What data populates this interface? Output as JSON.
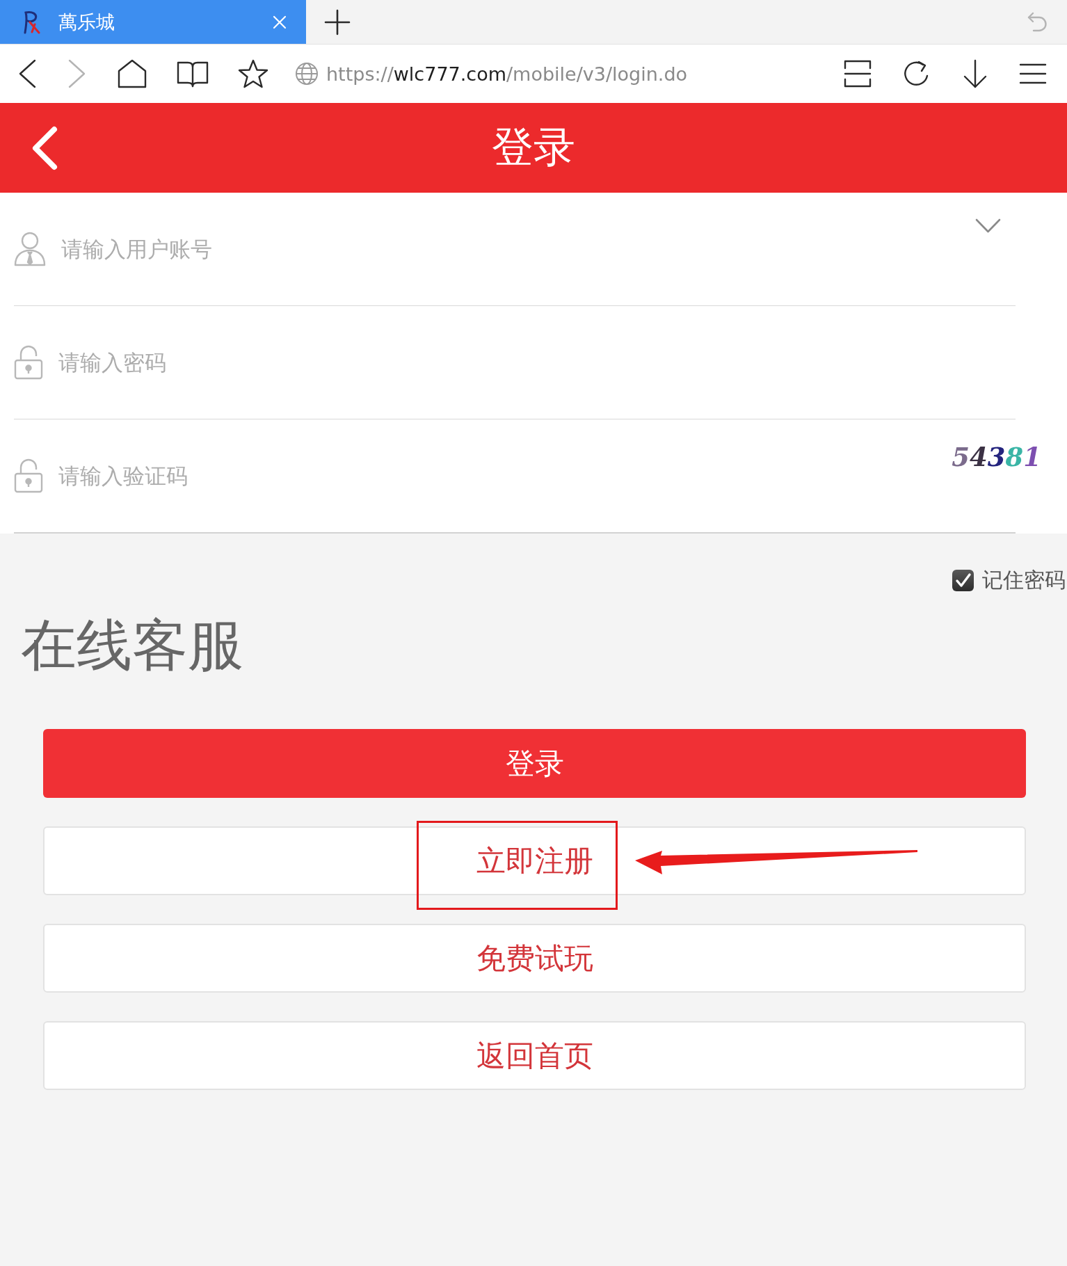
{
  "browser": {
    "tabs": [
      {
        "title": "萬乐城",
        "selected": true
      }
    ],
    "tab_actions": [
      {
        "kind": "undo",
        "disabled": true
      }
    ],
    "toolbar_left": [
      {
        "kind": "back",
        "disabled": false
      },
      {
        "kind": "forward",
        "disabled": true
      },
      {
        "kind": "home",
        "disabled": false
      },
      {
        "kind": "bookmarks",
        "disabled": false
      },
      {
        "kind": "favorite",
        "disabled": false
      }
    ],
    "address": {
      "scheme": "https://",
      "host": "wlc777.com",
      "path": "/mobile/v3/login.do"
    },
    "toolbar_right": [
      {
        "kind": "reader",
        "disabled": false
      },
      {
        "kind": "reload",
        "disabled": false
      },
      {
        "kind": "download",
        "disabled": false
      },
      {
        "kind": "menu",
        "disabled": false
      }
    ]
  },
  "header": {
    "title": "登录"
  },
  "fields": [
    {
      "kind": "account",
      "placeholder": "请输入用户账号"
    },
    {
      "kind": "password",
      "placeholder": "请输入密码"
    },
    {
      "kind": "captcha",
      "placeholder": "请输入验证码",
      "captcha": "54381"
    }
  ],
  "remember": {
    "label": "记住密码",
    "checked": true
  },
  "service_link": "在线客服",
  "buttons": [
    {
      "label": "登录",
      "kind": "primary",
      "highlighted": false
    },
    {
      "label": "立即注册",
      "kind": "secondary",
      "highlighted": true
    },
    {
      "label": "免费试玩",
      "kind": "secondary",
      "highlighted": false
    },
    {
      "label": "返回首页",
      "kind": "secondary",
      "highlighted": false
    }
  ]
}
